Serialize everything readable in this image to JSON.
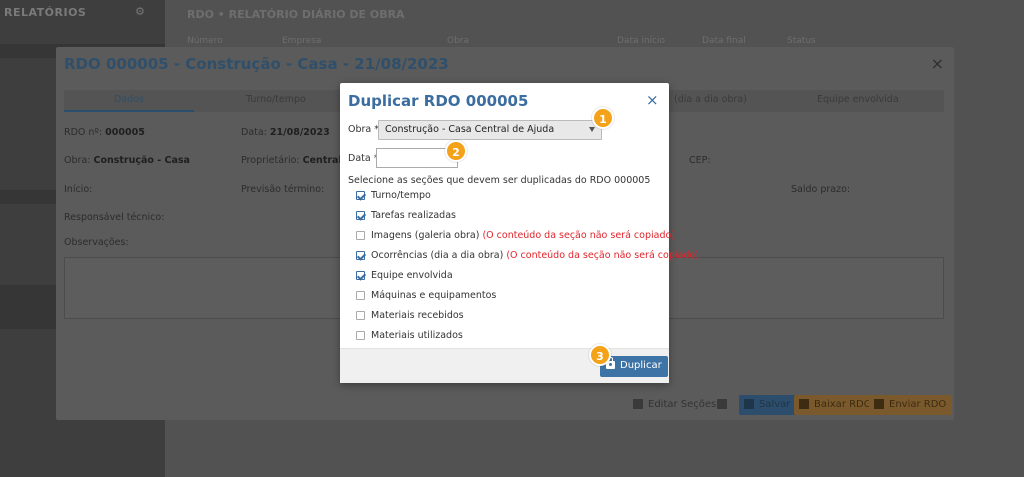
{
  "background": {
    "sidebar_title": "RELATÓRIOS",
    "main_title": "RDO • RELATÓRIO DIÁRIO DE OBRA",
    "columns": [
      "Número",
      "Empresa",
      "Obra",
      "Data início",
      "Data final",
      "Status"
    ]
  },
  "rdo_modal": {
    "title": "RDO 000005 - Construção - Casa - 21/08/2023",
    "tabs": [
      "Dados",
      "Turno/tempo",
      "",
      "",
      "(dia a dia obra)",
      "Equipe envolvida"
    ],
    "fields": {
      "rdo_label": "RDO nº:",
      "rdo_value": "000005",
      "data_label": "Data:",
      "data_value": "21/08/2023",
      "obra_label": "Obra:",
      "obra_value": "Construção - Casa",
      "proprietario_label": "Proprietário:",
      "proprietario_value": "Central d",
      "cep_label": "CEP:",
      "inicio_label": "Início:",
      "previsao_label": "Previsão término:",
      "saldo_label": "Saldo prazo:",
      "responsavel_label": "Responsável técnico:",
      "observacoes_label": "Observações:"
    },
    "footer": {
      "edit_sections": "Editar Seções",
      "save": "Salvar",
      "download": "Baixar RDO",
      "send": "Enviar RDO"
    }
  },
  "dialog": {
    "title": "Duplicar RDO 000005",
    "close_icon": "×",
    "obra_label": "Obra *",
    "obra_value": "Construção - Casa Central de Ajuda",
    "data_label": "Data *",
    "data_value": "",
    "hint": "Selecione as seções que devem ser duplicadas do RDO 000005",
    "sections": [
      {
        "label": "Turno/tempo",
        "checked": true,
        "warning": ""
      },
      {
        "label": "Tarefas realizadas",
        "checked": true,
        "warning": ""
      },
      {
        "label": "Imagens (galeria obra)",
        "checked": false,
        "warning": "(O conteúdo da seção não será copiado)"
      },
      {
        "label": "Ocorrências (dia a dia obra)",
        "checked": true,
        "warning": "(O conteúdo da seção não será copiado)"
      },
      {
        "label": "Equipe envolvida",
        "checked": true,
        "warning": ""
      },
      {
        "label": "Máquinas e equipamentos",
        "checked": false,
        "warning": ""
      },
      {
        "label": "Materiais recebidos",
        "checked": false,
        "warning": ""
      },
      {
        "label": "Materiais utilizados",
        "checked": false,
        "warning": ""
      }
    ],
    "duplicate_button": "Duplicar"
  },
  "badges": [
    "1",
    "2",
    "3"
  ],
  "colors": {
    "accent": "#3b6da0",
    "badge": "#f3a21a",
    "warning": "#e2242a"
  }
}
